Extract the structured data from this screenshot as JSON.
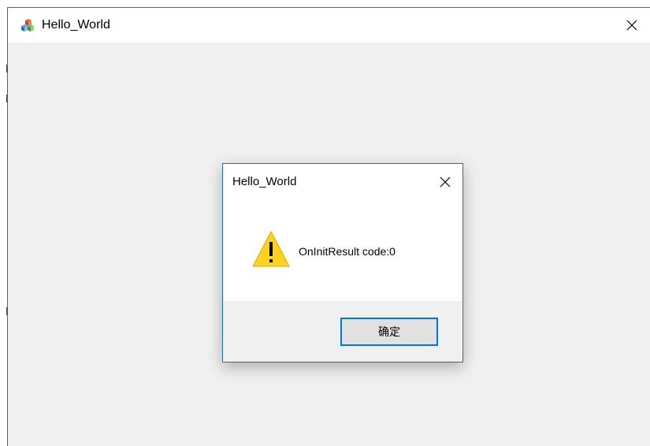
{
  "window": {
    "title": "Hello_World",
    "icon": "app-blocks-icon",
    "close_icon": "close-icon"
  },
  "dialog": {
    "title": "Hello_World",
    "icon": "warning-icon",
    "message": "OnInitResult code:0",
    "ok_label": "确定",
    "close_icon": "close-icon"
  },
  "colors": {
    "accent_border": "#1c6ec9",
    "button_focus": "#0078d7",
    "warning_fill": "#ffd21f",
    "client_bg": "#f0f0f0"
  }
}
